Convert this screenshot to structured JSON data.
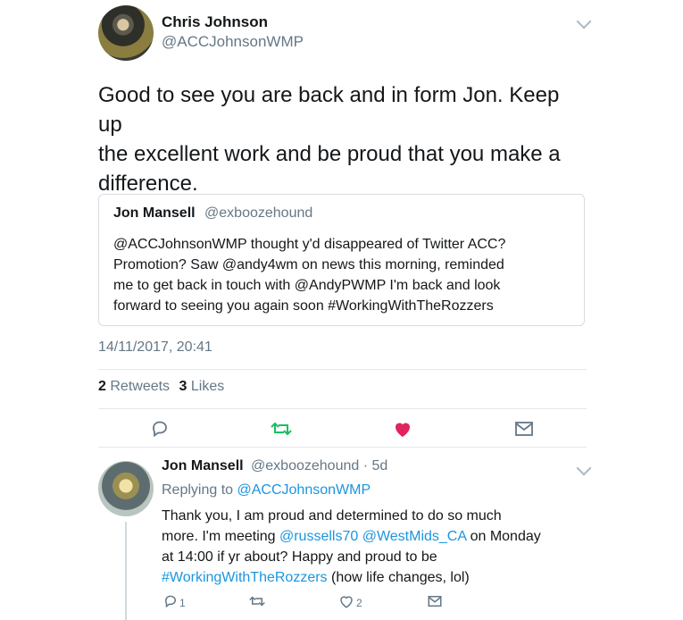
{
  "tweet": {
    "author_name": "Chris Johnson",
    "author_handle": "@ACCJohnsonWMP",
    "text_lines": [
      "Good to see you are back and in form Jon.  Keep up",
      "the excellent work and be proud that you make a",
      "difference."
    ],
    "timestamp": "14/11/2017, 20:41",
    "retweets": "2",
    "retweets_label": "Retweets",
    "likes": "3",
    "likes_label": "Likes"
  },
  "quote": {
    "author_name": "Jon Mansell",
    "author_handle": "@exboozehound",
    "text_lines": [
      "@ACCJohnsonWMP thought y'd disappeared of Twitter ACC?",
      "Promotion? Saw @andy4wm on news this morning, reminded",
      "me to get back in touch with @AndyPWMP I'm back and look",
      "forward to seeing you again soon #WorkingWithTheRozzers"
    ]
  },
  "reply": {
    "author_name": "Jon Mansell",
    "author_handle": "@exboozehound",
    "age": "· 5d",
    "replying_to_label": "Replying to",
    "replying_to_handle": "@ACCJohnsonWMP",
    "line1": "Thank you, I am proud and determined to do so much",
    "line2_a": "more. I'm meeting ",
    "line2_link1": "@russells70",
    "line2_space": " ",
    "line2_link2": "@WestMids_CA",
    "line2_b": " on Monday",
    "line3": "at 14:00 if yr about? Happy and proud to be",
    "line4_link": "#WorkingWithTheRozzers",
    "line4_b": " (how life changes, lol)",
    "reply_count": "1",
    "like_count": "2"
  },
  "icons": {
    "accent": "#1b95e0",
    "retweet": "#17bf63",
    "like": "#e0245e",
    "muted": "#657786"
  }
}
